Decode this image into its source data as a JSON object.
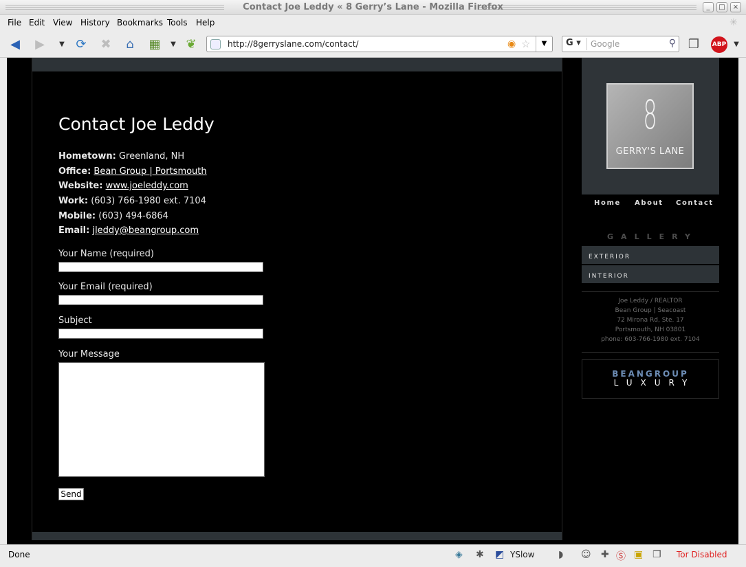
{
  "window": {
    "title": "Contact Joe Leddy « 8 Gerry’s Lane - Mozilla Firefox"
  },
  "menu": [
    "File",
    "Edit",
    "View",
    "History",
    "Bookmarks",
    "Tools",
    "Help"
  ],
  "navbar": {
    "url": "http://8gerryslane.com/contact/",
    "search_placeholder": "Google",
    "search_engine": "G",
    "abp_label": "ABP"
  },
  "page": {
    "title": "Contact Joe Leddy",
    "info": [
      {
        "label": "Hometown:",
        "value": "Greenland, NH",
        "link": false
      },
      {
        "label": "Office:",
        "value": "Bean Group | Portsmouth",
        "link": true
      },
      {
        "label": "Website:",
        "value": "www.joeleddy.com",
        "link": true
      },
      {
        "label": "Work:",
        "value": "(603) 766-1980 ext. 7104",
        "link": false
      },
      {
        "label": "Mobile:",
        "value": "(603) 494-6864",
        "link": false
      },
      {
        "label": "Email:",
        "value": "jleddy@beangroup.com",
        "link": true
      }
    ],
    "form": {
      "name_label": "Your Name (required)",
      "email_label": "Your Email (required)",
      "subject_label": "Subject",
      "message_label": "Your Message",
      "send_label": "Send"
    }
  },
  "sidebar": {
    "logo_number": "8",
    "logo_text": "GERRY'S LANE",
    "nav": [
      "Home",
      "About",
      "Contact"
    ],
    "gallery_heading": "GALLERY",
    "gallery_items": [
      "EXTERIOR",
      "INTERIOR"
    ],
    "address": [
      "Joe Leddy / REALTOR",
      "Bean Group | Seacoast",
      "72 Mirona Rd, Ste. 17",
      "Portsmouth, NH 03801",
      "phone: 603-766-1980 ext. 7104"
    ],
    "bean_top": "BEANGROUP",
    "bean_bottom": "LUXURY"
  },
  "status": {
    "text": "Done",
    "yslow": "YSlow",
    "tor": "Tor Disabled"
  },
  "colors": {
    "page_bg": "#000000",
    "strip": "#2d3337",
    "tor": "#e02020",
    "bean_blue": "#6c8cb4"
  }
}
